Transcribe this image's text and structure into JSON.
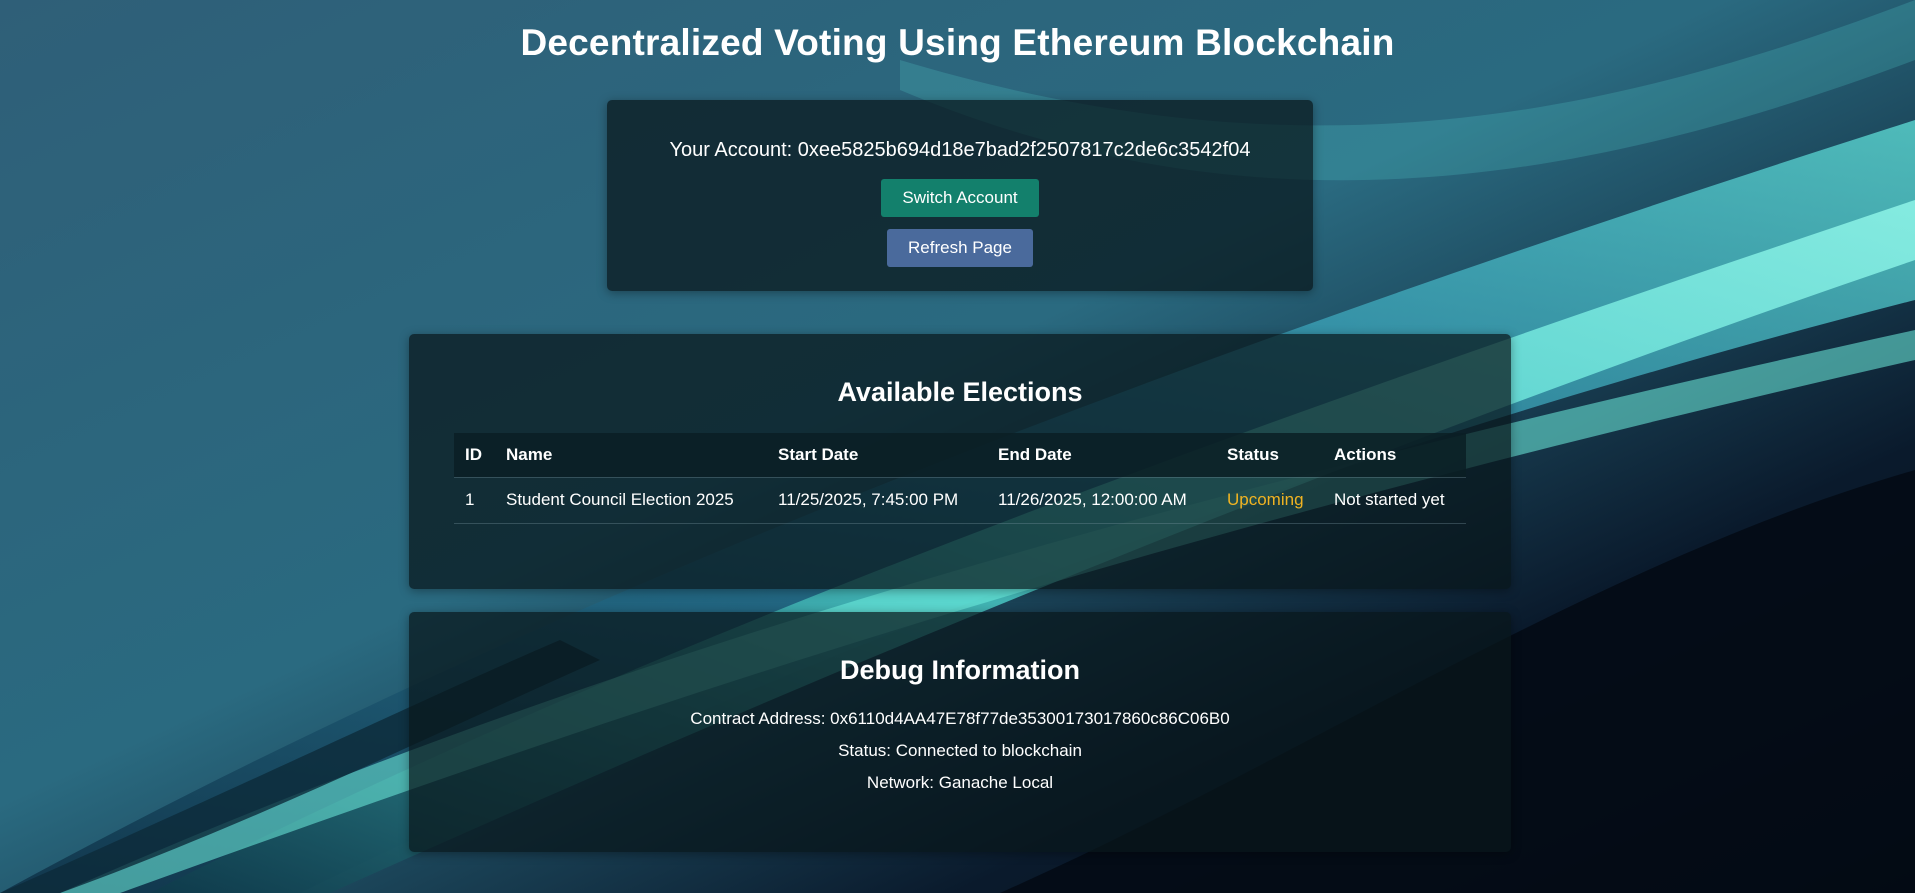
{
  "header": {
    "title": "Decentralized Voting Using Ethereum Blockchain"
  },
  "account": {
    "label": "Your Account:",
    "address": "0xee5825b694d18e7bad2f2507817c2de6c3542f04",
    "switch_label": "Switch Account",
    "refresh_label": "Refresh Page"
  },
  "elections": {
    "title": "Available Elections",
    "columns": [
      "ID",
      "Name",
      "Start Date",
      "End Date",
      "Status",
      "Actions"
    ],
    "rows": [
      {
        "id": "1",
        "name": "Student Council Election 2025",
        "start": "11/25/2025, 7:45:00 PM",
        "end": "11/26/2025, 12:00:00 AM",
        "status": "Upcoming",
        "action": "Not started yet"
      }
    ]
  },
  "debug": {
    "title": "Debug Information",
    "contract_line": "Contract Address: 0x6110d4AA47E78f77de35300173017860c86C06B0",
    "status_line": "Status: Connected to blockchain",
    "network_line": "Network: Ganache Local"
  },
  "colors": {
    "switch_button": "#13806c",
    "refresh_button": "#4a6a9c",
    "status_upcoming": "#f0b322"
  }
}
